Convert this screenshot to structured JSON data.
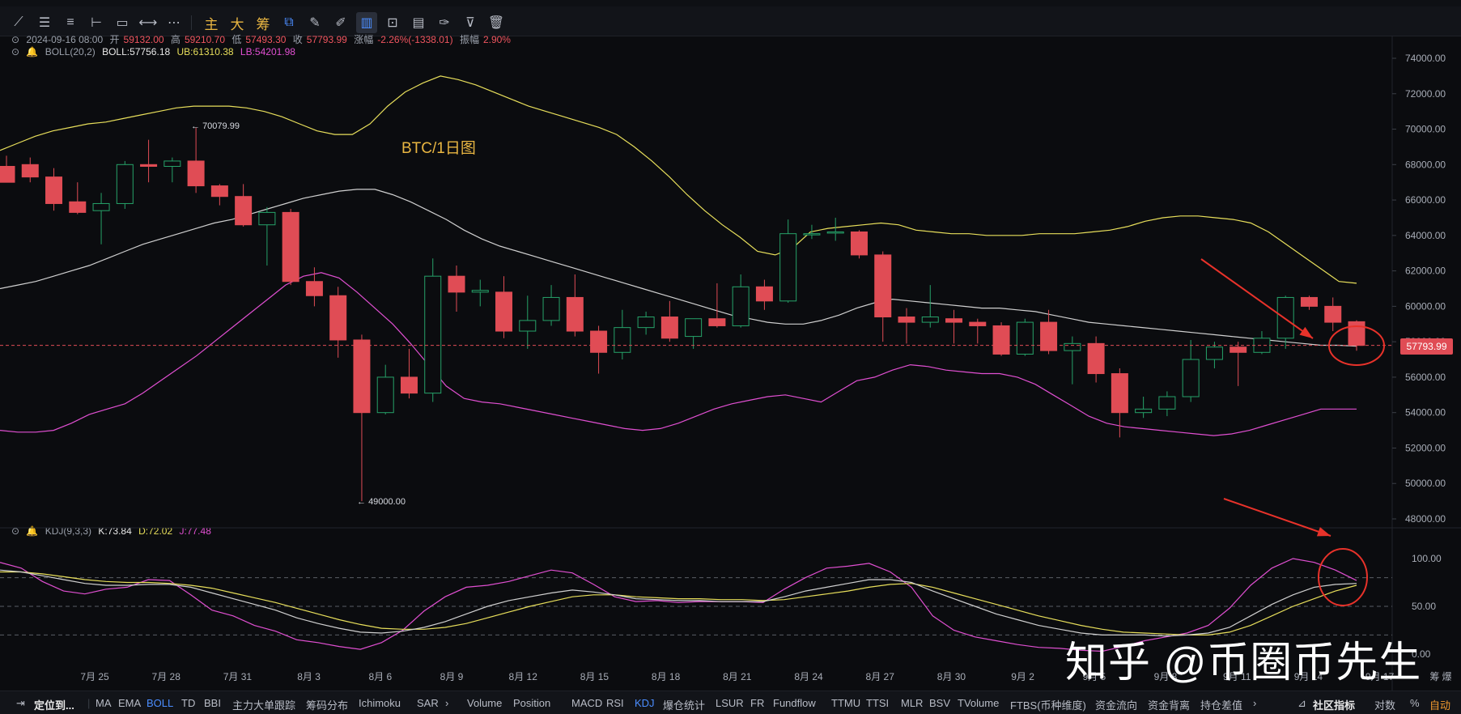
{
  "toolbar": {
    "tools": [
      {
        "name": "trend-line-tool",
        "glyph": "⟋"
      },
      {
        "name": "horizontal-lines-tool",
        "glyph": "☰"
      },
      {
        "name": "parallel-channel-tool",
        "glyph": "≡"
      },
      {
        "name": "horizontal-ray-tool",
        "glyph": "⊢"
      },
      {
        "name": "rectangle-tool",
        "glyph": "▭"
      },
      {
        "name": "measure-tool",
        "glyph": "⟷"
      },
      {
        "name": "more-tools",
        "glyph": "⋯"
      }
    ],
    "labels": {
      "main": "主",
      "big": "大",
      "chip": "筹"
    },
    "right_tools": [
      {
        "name": "magnet-icon",
        "glyph": "⧉"
      },
      {
        "name": "ruler-icon",
        "glyph": "✎"
      },
      {
        "name": "brush-icon",
        "glyph": "✐"
      },
      {
        "name": "candle-style-icon",
        "glyph": "▥"
      },
      {
        "name": "lock-icon",
        "glyph": "⊡"
      },
      {
        "name": "notes-icon",
        "glyph": "▤"
      },
      {
        "name": "draw-icon",
        "glyph": "✑"
      },
      {
        "name": "filter-icon",
        "glyph": "⊽"
      },
      {
        "name": "trash-icon",
        "glyph": "🗑"
      }
    ]
  },
  "ohlc": {
    "date": "2024-09-16 08:00",
    "open_label": "开",
    "open": "59132.00",
    "high_label": "高",
    "high": "59210.70",
    "low_label": "低",
    "low": "57493.30",
    "close_label": "收",
    "close": "57793.99",
    "change_label": "涨幅",
    "change": "-2.26%(-1338.01)",
    "amp_label": "振幅",
    "amp": "2.90%"
  },
  "boll": {
    "name": "BOLL(20,2)",
    "mid": "BOLL:57756.18",
    "ub": "UB:61310.38",
    "lb": "LB:54201.98"
  },
  "kdj": {
    "name": "KDJ(9,3,3)",
    "k": "K:73.84",
    "d": "D:72.02",
    "j": "J:77.48"
  },
  "chart_title": "BTC/1日图",
  "last_price": "57793.99",
  "annotations": {
    "high": "70079.99",
    "low": "49000.00"
  },
  "watermark": "知乎 @币圈币先生",
  "colors": {
    "up": "#26a269",
    "down": "#e04c55",
    "mid": "#d0d0d0",
    "ub": "#e8df5b",
    "lb": "#e04fd1",
    "accent": "#4b8dff",
    "arrow": "#e8322a"
  },
  "chart_data": {
    "type": "candlestick",
    "price_axis": {
      "ticks": [
        48000,
        50000,
        52000,
        54000,
        56000,
        58000,
        60000,
        62000,
        64000,
        66000,
        68000,
        70000,
        72000,
        74000
      ]
    },
    "x_ticks": [
      "7月 25",
      "7月 28",
      "7月 31",
      "8月 3",
      "8月 6",
      "8月 9",
      "8月 12",
      "8月 15",
      "8月 18",
      "8月 21",
      "8月 24",
      "8月 27",
      "8月 30",
      "9月 2",
      "9月 5",
      "9月 8",
      "9月 11",
      "9月 14",
      "9月 17"
    ],
    "x_ticks_extra": "筹 爆",
    "candles": [
      {
        "o": 67900,
        "h": 68500,
        "l": 67000,
        "c": 67000
      },
      {
        "o": 68000,
        "h": 68400,
        "l": 67000,
        "c": 67300
      },
      {
        "o": 67300,
        "h": 67800,
        "l": 65400,
        "c": 65800
      },
      {
        "o": 65900,
        "h": 67000,
        "l": 65200,
        "c": 65300
      },
      {
        "o": 65400,
        "h": 66400,
        "l": 63500,
        "c": 65800
      },
      {
        "o": 65800,
        "h": 68200,
        "l": 65500,
        "c": 68000
      },
      {
        "o": 68000,
        "h": 69400,
        "l": 67000,
        "c": 67900
      },
      {
        "o": 67900,
        "h": 68400,
        "l": 67000,
        "c": 68200
      },
      {
        "o": 68200,
        "h": 70080,
        "l": 66400,
        "c": 66800
      },
      {
        "o": 66800,
        "h": 66900,
        "l": 65700,
        "c": 66200
      },
      {
        "o": 66200,
        "h": 66900,
        "l": 64500,
        "c": 64600
      },
      {
        "o": 64600,
        "h": 65600,
        "l": 62300,
        "c": 65300
      },
      {
        "o": 65300,
        "h": 65500,
        "l": 61200,
        "c": 61400
      },
      {
        "o": 61400,
        "h": 62200,
        "l": 60000,
        "c": 60600
      },
      {
        "o": 60600,
        "h": 61100,
        "l": 57100,
        "c": 58100
      },
      {
        "o": 58100,
        "h": 58400,
        "l": 49000,
        "c": 54000
      },
      {
        "o": 54000,
        "h": 56700,
        "l": 53900,
        "c": 56000
      },
      {
        "o": 56000,
        "h": 57600,
        "l": 54800,
        "c": 55100
      },
      {
        "o": 55100,
        "h": 62700,
        "l": 54600,
        "c": 61700
      },
      {
        "o": 61700,
        "h": 62300,
        "l": 59700,
        "c": 60800
      },
      {
        "o": 60800,
        "h": 61500,
        "l": 60000,
        "c": 60900
      },
      {
        "o": 60800,
        "h": 61700,
        "l": 58200,
        "c": 58600
      },
      {
        "o": 58600,
        "h": 60600,
        "l": 57600,
        "c": 59200
      },
      {
        "o": 59200,
        "h": 61200,
        "l": 58900,
        "c": 60500
      },
      {
        "o": 60500,
        "h": 61800,
        "l": 58300,
        "c": 58600
      },
      {
        "o": 58600,
        "h": 58900,
        "l": 56200,
        "c": 57400
      },
      {
        "o": 57400,
        "h": 59800,
        "l": 57000,
        "c": 58800
      },
      {
        "o": 58800,
        "h": 59700,
        "l": 58400,
        "c": 59400
      },
      {
        "o": 59400,
        "h": 60300,
        "l": 58000,
        "c": 58200
      },
      {
        "o": 58300,
        "h": 59300,
        "l": 57600,
        "c": 59300
      },
      {
        "o": 59300,
        "h": 61300,
        "l": 58800,
        "c": 58900
      },
      {
        "o": 58900,
        "h": 61800,
        "l": 58800,
        "c": 61100
      },
      {
        "o": 61100,
        "h": 61500,
        "l": 59800,
        "c": 60300
      },
      {
        "o": 60300,
        "h": 64900,
        "l": 60200,
        "c": 64100
      },
      {
        "o": 64100,
        "h": 64600,
        "l": 63800,
        "c": 64100
      },
      {
        "o": 64200,
        "h": 65000,
        "l": 63700,
        "c": 64200
      },
      {
        "o": 64200,
        "h": 64300,
        "l": 62700,
        "c": 62900
      },
      {
        "o": 62900,
        "h": 63100,
        "l": 58000,
        "c": 59400
      },
      {
        "o": 59400,
        "h": 59900,
        "l": 57900,
        "c": 59100
      },
      {
        "o": 59100,
        "h": 61200,
        "l": 58800,
        "c": 59400
      },
      {
        "o": 59300,
        "h": 59800,
        "l": 57900,
        "c": 59100
      },
      {
        "o": 59100,
        "h": 59300,
        "l": 57900,
        "c": 58900
      },
      {
        "o": 58900,
        "h": 59100,
        "l": 57200,
        "c": 57300
      },
      {
        "o": 57300,
        "h": 59300,
        "l": 57200,
        "c": 59100
      },
      {
        "o": 59100,
        "h": 59800,
        "l": 57300,
        "c": 57500
      },
      {
        "o": 57500,
        "h": 58300,
        "l": 55600,
        "c": 57900
      },
      {
        "o": 57900,
        "h": 58300,
        "l": 55700,
        "c": 56200
      },
      {
        "o": 56200,
        "h": 56500,
        "l": 52600,
        "c": 54000
      },
      {
        "o": 54000,
        "h": 54900,
        "l": 53700,
        "c": 54200
      },
      {
        "o": 54200,
        "h": 55200,
        "l": 53800,
        "c": 54900
      },
      {
        "o": 54900,
        "h": 58100,
        "l": 54600,
        "c": 57000
      },
      {
        "o": 57000,
        "h": 58000,
        "l": 56500,
        "c": 57700
      },
      {
        "o": 57700,
        "h": 58000,
        "l": 55500,
        "c": 57400
      },
      {
        "o": 57400,
        "h": 58600,
        "l": 57300,
        "c": 58200
      },
      {
        "o": 58200,
        "h": 60600,
        "l": 57600,
        "c": 60500
      },
      {
        "o": 60500,
        "h": 60600,
        "l": 59800,
        "c": 60000
      },
      {
        "o": 60000,
        "h": 60500,
        "l": 58600,
        "c": 59100
      },
      {
        "o": 59132,
        "h": 59210.7,
        "l": 57493.3,
        "c": 57793.99
      }
    ],
    "boll_mid": [
      61000,
      61200,
      61400,
      61700,
      62000,
      62300,
      62700,
      63100,
      63500,
      63800,
      64100,
      64400,
      64700,
      64900,
      65200,
      65500,
      65800,
      66100,
      66300,
      66500,
      66600,
      66600,
      66300,
      65900,
      65400,
      64900,
      64300,
      63800,
      63400,
      63100,
      62800,
      62500,
      62200,
      61900,
      61600,
      61300,
      61000,
      60700,
      60400,
      60100,
      59800,
      59500,
      59300,
      59100,
      59000,
      59000,
      59200,
      59500,
      59900,
      60200,
      60400,
      60300,
      60200,
      60100,
      60000,
      59900,
      59900,
      59800,
      59700,
      59500,
      59300,
      59100,
      59000,
      58900,
      58800,
      58700,
      58600,
      58500,
      58400,
      58300,
      58200,
      58100,
      58000,
      57900,
      57800,
      57800,
      57750
    ],
    "boll_ub": [
      68800,
      69200,
      69600,
      69900,
      70100,
      70300,
      70400,
      70600,
      70800,
      71000,
      71200,
      71300,
      71300,
      71300,
      71200,
      71000,
      70700,
      70300,
      69900,
      69700,
      69700,
      70300,
      71300,
      72100,
      72600,
      73000,
      72800,
      72500,
      72100,
      71700,
      71300,
      71000,
      70700,
      70400,
      70100,
      69700,
      69000,
      68200,
      67300,
      66300,
      65400,
      64600,
      63900,
      63100,
      62900,
      63300,
      64200,
      64400,
      64500,
      64600,
      64700,
      64600,
      64300,
      64200,
      64100,
      64100,
      64000,
      64000,
      64000,
      64100,
      64100,
      64100,
      64200,
      64300,
      64500,
      64800,
      65000,
      65100,
      65100,
      65000,
      64900,
      64700,
      64200,
      63500,
      62800,
      62100,
      61400,
      61300
    ],
    "boll_lb": [
      53000,
      52900,
      52900,
      53000,
      53400,
      53900,
      54200,
      54500,
      55100,
      55800,
      56500,
      57200,
      58000,
      58800,
      59600,
      60400,
      61200,
      61700,
      61900,
      61600,
      60800,
      59900,
      59000,
      57900,
      56700,
      55500,
      54800,
      54600,
      54500,
      54300,
      54100,
      53900,
      53700,
      53500,
      53300,
      53100,
      53000,
      53100,
      53400,
      53800,
      54200,
      54500,
      54700,
      54900,
      55000,
      54800,
      54600,
      55200,
      55800,
      56000,
      56400,
      56700,
      56600,
      56400,
      56300,
      56200,
      56200,
      56000,
      55600,
      55000,
      54400,
      53800,
      53400,
      53200,
      53100,
      53000,
      52900,
      52800,
      52700,
      52800,
      53000,
      53300,
      53600,
      53900,
      54200,
      54200,
      54200
    ],
    "kdj_axis": {
      "ticks": [
        0.0,
        50.0,
        100.0
      ],
      "levels": [
        20,
        50,
        80
      ]
    },
    "kdj_k": [
      88,
      86,
      82,
      78,
      74,
      72,
      72,
      73,
      73,
      70,
      64,
      58,
      52,
      46,
      38,
      32,
      27,
      23,
      22,
      24,
      28,
      34,
      42,
      50,
      56,
      60,
      64,
      67,
      65,
      62,
      58,
      57,
      56,
      56,
      55,
      55,
      55,
      60,
      66,
      70,
      74,
      78,
      78,
      75,
      66,
      58,
      50,
      42,
      36,
      30,
      26,
      22,
      20,
      20,
      20,
      19,
      20,
      22,
      28,
      40,
      52,
      62,
      70,
      73,
      74
    ],
    "kdj_d": [
      86,
      86,
      84,
      81,
      78,
      76,
      75,
      75,
      74,
      72,
      69,
      64,
      59,
      54,
      48,
      42,
      36,
      31,
      27,
      26,
      26,
      28,
      32,
      38,
      44,
      50,
      55,
      60,
      62,
      62,
      60,
      59,
      58,
      58,
      57,
      57,
      56,
      57,
      60,
      63,
      66,
      70,
      73,
      74,
      70,
      64,
      58,
      52,
      46,
      40,
      35,
      30,
      26,
      23,
      22,
      21,
      20,
      20,
      23,
      30,
      40,
      50,
      58,
      66,
      72
    ],
    "kdj_j": [
      96,
      90,
      76,
      66,
      63,
      68,
      70,
      78,
      77,
      62,
      46,
      40,
      30,
      24,
      15,
      12,
      8,
      5,
      12,
      25,
      45,
      60,
      70,
      72,
      76,
      82,
      88,
      85,
      73,
      60,
      55,
      56,
      54,
      55,
      55,
      55,
      54,
      68,
      80,
      90,
      92,
      95,
      86,
      70,
      40,
      25,
      18,
      14,
      10,
      7,
      6,
      4,
      3,
      8,
      14,
      18,
      22,
      30,
      48,
      72,
      90,
      100,
      96,
      88,
      77
    ]
  },
  "bottom_bar": {
    "locate": "定位到...",
    "indicators": [
      "MA",
      "EMA",
      "BOLL",
      "TD",
      "BBI",
      "主力大单跟踪",
      "筹码分布",
      "Ichimoku",
      "SAR",
      "›",
      "Volume",
      "Position",
      "MACD",
      "RSI",
      "KDJ",
      "爆仓统计",
      "LSUR",
      "FR",
      "Fundflow",
      "TTMU",
      "TTSI",
      "MLR",
      "BSV",
      "TVolume",
      "FTBS(币种维度)",
      "资金流向",
      "资金背离",
      "持仓差值",
      "›"
    ],
    "community": "社区指标",
    "log": "对数",
    "percent": "%",
    "auto": "自动"
  }
}
